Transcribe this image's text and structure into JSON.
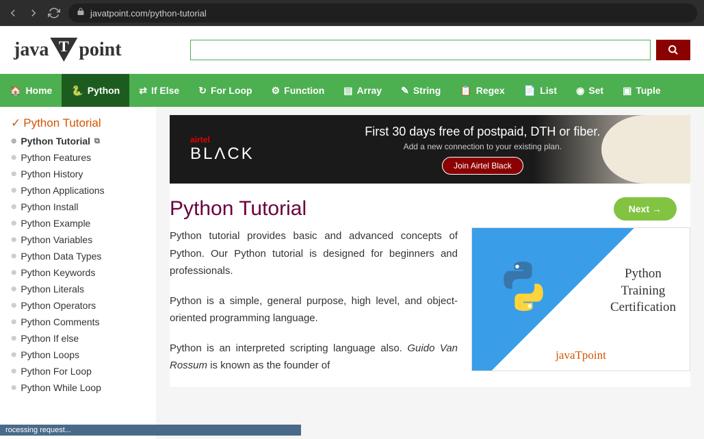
{
  "browser": {
    "url": "javatpoint.com/python-tutorial"
  },
  "header": {
    "logo_left": "java",
    "logo_t": "T",
    "logo_right": "point",
    "search_placeholder": ""
  },
  "nav": [
    {
      "icon": "home",
      "label": "Home"
    },
    {
      "icon": "python",
      "label": "Python"
    },
    {
      "icon": "branch",
      "label": "If Else"
    },
    {
      "icon": "loop",
      "label": "For Loop"
    },
    {
      "icon": "fn",
      "label": "Function"
    },
    {
      "icon": "array",
      "label": "Array"
    },
    {
      "icon": "string",
      "label": "String"
    },
    {
      "icon": "regex",
      "label": "Regex"
    },
    {
      "icon": "list",
      "label": "List"
    },
    {
      "icon": "set",
      "label": "Set"
    },
    {
      "icon": "tuple",
      "label": "Tuple"
    }
  ],
  "sidebar": {
    "header": "Python Tutorial",
    "items": [
      {
        "label": "Python Tutorial",
        "active": true,
        "ext": true
      },
      {
        "label": "Python Features"
      },
      {
        "label": "Python History"
      },
      {
        "label": "Python Applications"
      },
      {
        "label": "Python Install"
      },
      {
        "label": "Python Example"
      },
      {
        "label": "Python Variables"
      },
      {
        "label": "Python Data Types"
      },
      {
        "label": "Python Keywords"
      },
      {
        "label": "Python Literals"
      },
      {
        "label": "Python Operators"
      },
      {
        "label": "Python Comments"
      },
      {
        "label": "Python If else"
      },
      {
        "label": "Python Loops"
      },
      {
        "label": "Python For Loop"
      },
      {
        "label": "Python While Loop"
      }
    ]
  },
  "ad": {
    "brand_top": "airtel",
    "brand_bottom": "BLΛCK",
    "title": "First 30 days free of  postpaid, DTH or fiber.",
    "subtitle": "Add a new connection to  your existing plan.",
    "cta": "Join Airtel Black"
  },
  "content": {
    "title": "Python Tutorial",
    "next_label": "Next →",
    "p1": "Python tutorial provides basic and advanced concepts of Python. Our Python tutorial is designed for beginners and professionals.",
    "p2": "Python is a simple, general purpose, high level, and object-oriented programming language.",
    "p3a": "Python is an interpreted scripting language also. ",
    "p3_italic": "Guido Van Rossum",
    "p3b": " is known as the founder of"
  },
  "cert": {
    "line1": "Python",
    "line2": "Training",
    "line3": "Certification",
    "brand": "javaTpoint"
  },
  "status": "rocessing request..."
}
